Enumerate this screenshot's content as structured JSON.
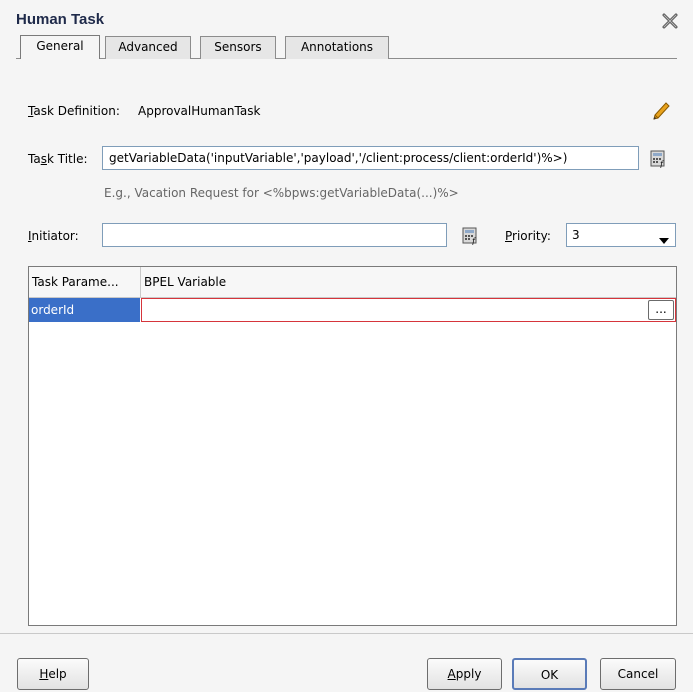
{
  "dialog": {
    "title": "Human Task",
    "close_icon": "close-icon"
  },
  "tabs": [
    {
      "label": "General",
      "active": true
    },
    {
      "label": "Advanced",
      "active": false
    },
    {
      "label": "Sensors",
      "active": false
    },
    {
      "label": "Annotations",
      "active": false
    }
  ],
  "general": {
    "task_definition_prefix": "T",
    "task_definition_rest": "ask Definition:",
    "task_definition_value": "ApprovalHumanTask",
    "edit_icon": "pencil-icon",
    "task_title_prefix": "Ta",
    "task_title_u": "s",
    "task_title_rest": "k Title:",
    "task_title_value": "getVariableData('inputVariable','payload','/client:process/client:orderId')%>)",
    "task_title_hint": "E.g., Vacation Request for <%bpws:getVariableData(...)%>",
    "expression_icon": "expression-builder-icon",
    "initiator_u": "I",
    "initiator_rest": "nitiator:",
    "initiator_value": "",
    "priority_u": "P",
    "priority_rest": "riority:",
    "priority_value": "3"
  },
  "table": {
    "columns": [
      "Task Parame...",
      "BPEL Variable"
    ],
    "rows": [
      {
        "parameter": "orderId",
        "variable": ""
      }
    ],
    "browse_label": "..."
  },
  "buttons": {
    "help_u": "H",
    "help_rest": "elp",
    "apply_u": "A",
    "apply_rest": "pply",
    "ok": "OK",
    "cancel": "Cancel"
  },
  "colors": {
    "selection": "#3a6fc8",
    "error_border": "#d6353b",
    "title": "#1f2a4a"
  }
}
